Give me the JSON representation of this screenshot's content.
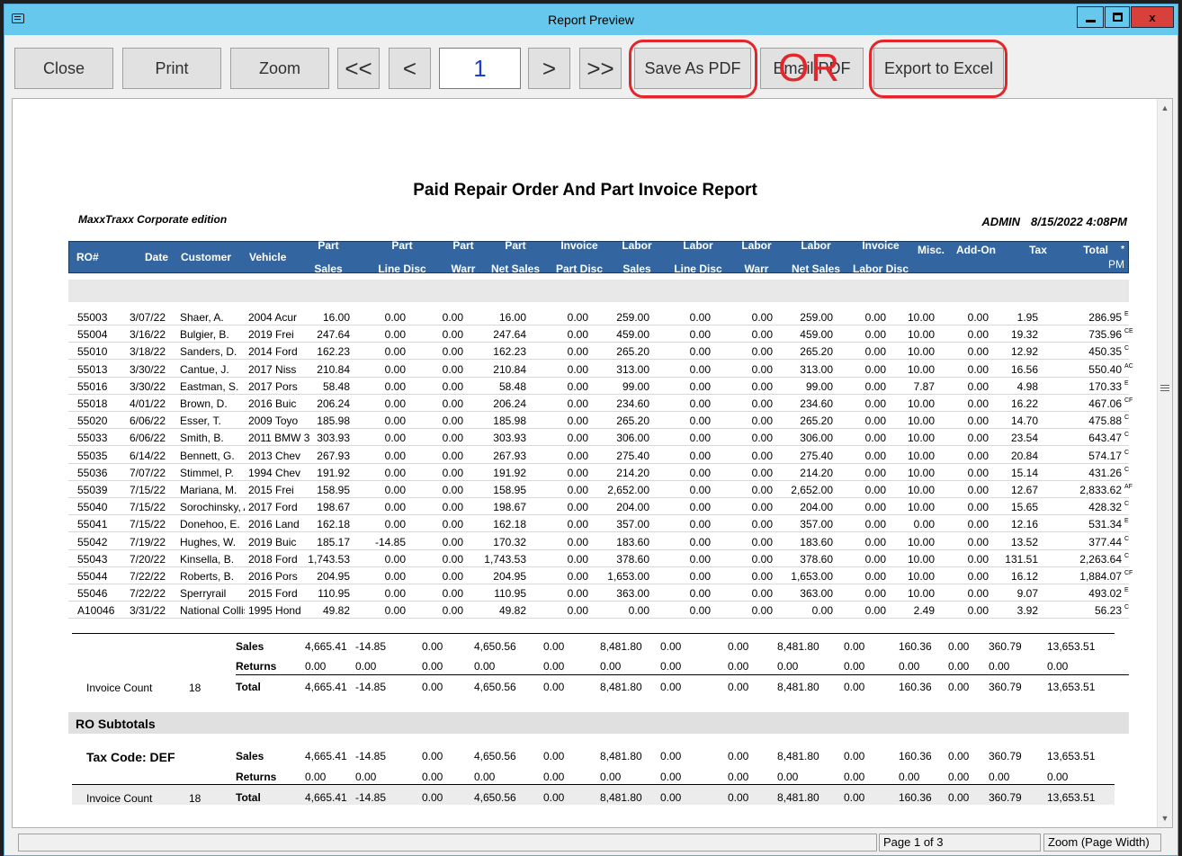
{
  "window": {
    "title": "Report Preview",
    "minimize_icon": "minimize-icon",
    "maximize_icon": "maximize-icon",
    "close_label": "x"
  },
  "toolbar": {
    "close_label": "Close",
    "print_label": "Print",
    "zoom_label": "Zoom",
    "first_label": "<<",
    "prev_label": "<",
    "page_value": "1",
    "next_label": ">",
    "last_label": ">>",
    "save_pdf_label": "Save As PDF",
    "email_pdf_label": "Email PDF",
    "export_excel_label": "Export to Excel",
    "annotation_or": "OR",
    "annotation_color": "#e2262b"
  },
  "report": {
    "title": "Paid Repair Order And Part Invoice Report",
    "edition": "MaxxTraxx Corporate edition",
    "user": "ADMIN",
    "datetime": "8/15/2022  4:08PM",
    "header_color": "#3366a0",
    "columns": [
      {
        "l1": "RO#",
        "l2": ""
      },
      {
        "l1": "Date",
        "l2": ""
      },
      {
        "l1": "Customer",
        "l2": ""
      },
      {
        "l1": "Vehicle",
        "l2": ""
      },
      {
        "l1": "Part",
        "l2": "Sales"
      },
      {
        "l1": "Part",
        "l2": "Line Disc"
      },
      {
        "l1": "Part",
        "l2": "Warr"
      },
      {
        "l1": "Part",
        "l2": "Net Sales"
      },
      {
        "l1": "Invoice",
        "l2": "Part Disc"
      },
      {
        "l1": "Labor",
        "l2": "Sales"
      },
      {
        "l1": "Labor",
        "l2": "Line Disc"
      },
      {
        "l1": "Labor",
        "l2": "Warr"
      },
      {
        "l1": "Labor",
        "l2": "Net Sales"
      },
      {
        "l1": "Invoice",
        "l2": "Labor Disc"
      },
      {
        "l1": "Misc.",
        "l2": ""
      },
      {
        "l1": "Add-On",
        "l2": ""
      },
      {
        "l1": "Tax",
        "l2": ""
      },
      {
        "l1": "Total",
        "l2": ""
      }
    ],
    "col_star": "*",
    "col_pm": "PM",
    "rows": [
      [
        "55003",
        "3/07/22",
        "Shaer, A.",
        "2004 Acur",
        "16.00",
        "0.00",
        "0.00",
        "16.00",
        "0.00",
        "259.00",
        "0.00",
        "0.00",
        "259.00",
        "0.00",
        "10.00",
        "0.00",
        "1.95",
        "286.95",
        "E"
      ],
      [
        "55004",
        "3/16/22",
        "Bulgier, B.",
        "2019 Frei",
        "247.64",
        "0.00",
        "0.00",
        "247.64",
        "0.00",
        "459.00",
        "0.00",
        "0.00",
        "459.00",
        "0.00",
        "10.00",
        "0.00",
        "19.32",
        "735.96",
        "CE"
      ],
      [
        "55010",
        "3/18/22",
        "Sanders, D.",
        "2014 Ford",
        "162.23",
        "0.00",
        "0.00",
        "162.23",
        "0.00",
        "265.20",
        "0.00",
        "0.00",
        "265.20",
        "0.00",
        "10.00",
        "0.00",
        "12.92",
        "450.35",
        "C"
      ],
      [
        "55013",
        "3/30/22",
        "Cantue, J.",
        "2017 Niss",
        "210.84",
        "0.00",
        "0.00",
        "210.84",
        "0.00",
        "313.00",
        "0.00",
        "0.00",
        "313.00",
        "0.00",
        "10.00",
        "0.00",
        "16.56",
        "550.40",
        "AC"
      ],
      [
        "55016",
        "3/30/22",
        "Eastman, S.",
        "2017 Pors",
        "58.48",
        "0.00",
        "0.00",
        "58.48",
        "0.00",
        "99.00",
        "0.00",
        "0.00",
        "99.00",
        "0.00",
        "7.87",
        "0.00",
        "4.98",
        "170.33",
        "E"
      ],
      [
        "55018",
        "4/01/22",
        "Brown, D.",
        "2016 Buic",
        "206.24",
        "0.00",
        "0.00",
        "206.24",
        "0.00",
        "234.60",
        "0.00",
        "0.00",
        "234.60",
        "0.00",
        "10.00",
        "0.00",
        "16.22",
        "467.06",
        "CF"
      ],
      [
        "55020",
        "6/06/22",
        "Esser, T.",
        "2009 Toyo",
        "185.98",
        "0.00",
        "0.00",
        "185.98",
        "0.00",
        "265.20",
        "0.00",
        "0.00",
        "265.20",
        "0.00",
        "10.00",
        "0.00",
        "14.70",
        "475.88",
        "C"
      ],
      [
        "55033",
        "6/06/22",
        "Smith, B.",
        "2011 BMW 3",
        "303.93",
        "0.00",
        "0.00",
        "303.93",
        "0.00",
        "306.00",
        "0.00",
        "0.00",
        "306.00",
        "0.00",
        "10.00",
        "0.00",
        "23.54",
        "643.47",
        "C"
      ],
      [
        "55035",
        "6/14/22",
        "Bennett, G.",
        "2013 Chev",
        "267.93",
        "0.00",
        "0.00",
        "267.93",
        "0.00",
        "275.40",
        "0.00",
        "0.00",
        "275.40",
        "0.00",
        "10.00",
        "0.00",
        "20.84",
        "574.17",
        "C"
      ],
      [
        "55036",
        "7/07/22",
        "Stimmel, P.",
        "1994 Chev",
        "191.92",
        "0.00",
        "0.00",
        "191.92",
        "0.00",
        "214.20",
        "0.00",
        "0.00",
        "214.20",
        "0.00",
        "10.00",
        "0.00",
        "15.14",
        "431.26",
        "C"
      ],
      [
        "55039",
        "7/15/22",
        "Mariana, M.",
        "2015 Frei",
        "158.95",
        "0.00",
        "0.00",
        "158.95",
        "0.00",
        "2,652.00",
        "0.00",
        "0.00",
        "2,652.00",
        "0.00",
        "10.00",
        "0.00",
        "12.67",
        "2,833.62",
        "AF"
      ],
      [
        "55040",
        "7/15/22",
        "Sorochinsky, A",
        "2017 Ford",
        "198.67",
        "0.00",
        "0.00",
        "198.67",
        "0.00",
        "204.00",
        "0.00",
        "0.00",
        "204.00",
        "0.00",
        "10.00",
        "0.00",
        "15.65",
        "428.32",
        "C"
      ],
      [
        "55041",
        "7/15/22",
        "Donehoo, E.",
        "2016 Land",
        "162.18",
        "0.00",
        "0.00",
        "162.18",
        "0.00",
        "357.00",
        "0.00",
        "0.00",
        "357.00",
        "0.00",
        "0.00",
        "0.00",
        "12.16",
        "531.34",
        "E"
      ],
      [
        "55042",
        "7/19/22",
        "Hughes, W.",
        "2019 Buic",
        "185.17",
        "-14.85",
        "0.00",
        "170.32",
        "0.00",
        "183.60",
        "0.00",
        "0.00",
        "183.60",
        "0.00",
        "10.00",
        "0.00",
        "13.52",
        "377.44",
        "C"
      ],
      [
        "55043",
        "7/20/22",
        "Kinsella, B.",
        "2018 Ford",
        "1,743.53",
        "0.00",
        "0.00",
        "1,743.53",
        "0.00",
        "378.60",
        "0.00",
        "0.00",
        "378.60",
        "0.00",
        "10.00",
        "0.00",
        "131.51",
        "2,263.64",
        "C"
      ],
      [
        "55044",
        "7/22/22",
        "Roberts, B.",
        "2016 Pors",
        "204.95",
        "0.00",
        "0.00",
        "204.95",
        "0.00",
        "1,653.00",
        "0.00",
        "0.00",
        "1,653.00",
        "0.00",
        "10.00",
        "0.00",
        "16.12",
        "1,884.07",
        "CF"
      ],
      [
        "55046",
        "7/22/22",
        "Sperryrail",
        "2015 Ford",
        "110.95",
        "0.00",
        "0.00",
        "110.95",
        "0.00",
        "363.00",
        "0.00",
        "0.00",
        "363.00",
        "0.00",
        "10.00",
        "0.00",
        "9.07",
        "493.02",
        "E"
      ],
      [
        "A10046",
        "3/31/22",
        "National Collis",
        "1995 Hond",
        "49.82",
        "0.00",
        "0.00",
        "49.82",
        "0.00",
        "0.00",
        "0.00",
        "0.00",
        "0.00",
        "0.00",
        "2.49",
        "0.00",
        "3.92",
        "56.23",
        "C"
      ]
    ],
    "summary": {
      "sales": {
        "label": "Sales",
        "values": [
          "4,665.41",
          "-14.85",
          "0.00",
          "4,650.56",
          "0.00",
          "8,481.80",
          "0.00",
          "0.00",
          "8,481.80",
          "0.00",
          "160.36",
          "0.00",
          "360.79",
          "13,653.51"
        ]
      },
      "returns": {
        "label": "Returns",
        "values": [
          "0.00",
          "0.00",
          "0.00",
          "0.00",
          "0.00",
          "0.00",
          "0.00",
          "0.00",
          "0.00",
          "0.00",
          "0.00",
          "0.00",
          "0.00",
          "0.00"
        ]
      },
      "total": {
        "label": "Total",
        "values": [
          "4,665.41",
          "-14.85",
          "0.00",
          "4,650.56",
          "0.00",
          "8,481.80",
          "0.00",
          "0.00",
          "8,481.80",
          "0.00",
          "160.36",
          "0.00",
          "360.79",
          "13,653.51"
        ]
      },
      "invoice_count_label": "Invoice Count",
      "invoice_count": "18"
    },
    "ro_subtotals": {
      "heading": "RO Subtotals",
      "tax_code": "Tax Code:  DEF",
      "sales": {
        "label": "Sales",
        "values": [
          "4,665.41",
          "-14.85",
          "0.00",
          "4,650.56",
          "0.00",
          "8,481.80",
          "0.00",
          "0.00",
          "8,481.80",
          "0.00",
          "160.36",
          "0.00",
          "360.79",
          "13,653.51"
        ]
      },
      "returns": {
        "label": "Returns",
        "values": [
          "0.00",
          "0.00",
          "0.00",
          "0.00",
          "0.00",
          "0.00",
          "0.00",
          "0.00",
          "0.00",
          "0.00",
          "0.00",
          "0.00",
          "0.00",
          "0.00"
        ]
      },
      "total": {
        "label": "Total",
        "values": [
          "4,665.41",
          "-14.85",
          "0.00",
          "4,650.56",
          "0.00",
          "8,481.80",
          "0.00",
          "0.00",
          "8,481.80",
          "0.00",
          "160.36",
          "0.00",
          "360.79",
          "13,653.51"
        ]
      },
      "invoice_count_label": "Invoice Count",
      "invoice_count": "18"
    }
  },
  "statusbar": {
    "page_info": "Page 1 of 3",
    "zoom_info": "Zoom (Page Width)"
  }
}
